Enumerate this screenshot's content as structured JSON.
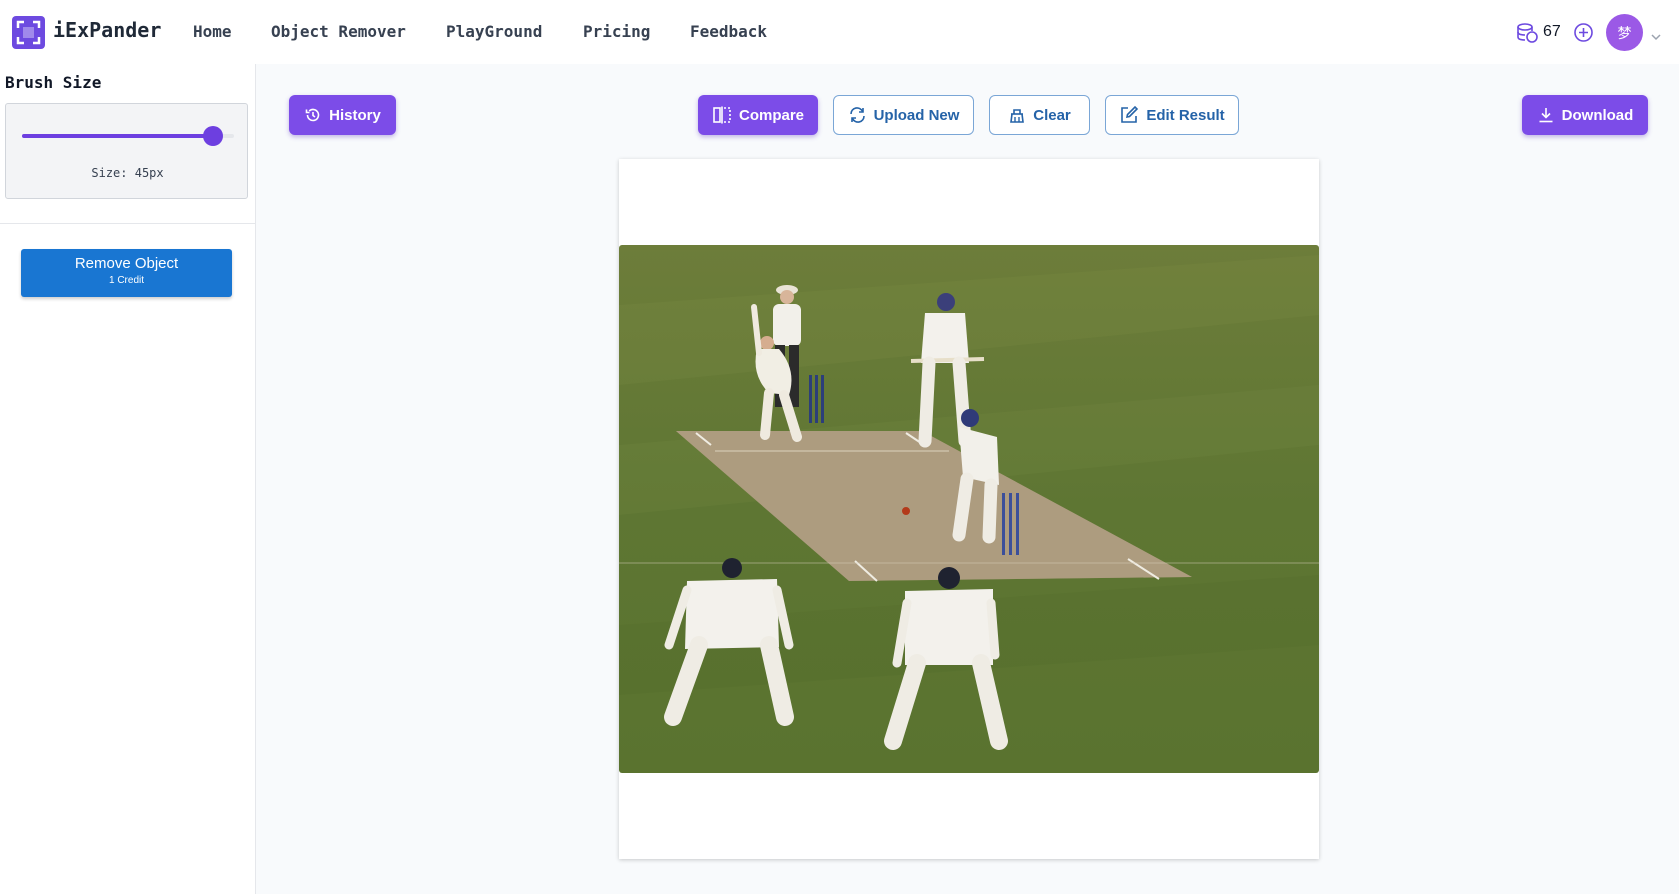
{
  "app": {
    "name": "iExPander"
  },
  "nav": {
    "home": "Home",
    "object_remover": "Object Remover",
    "playground": "PlayGround",
    "pricing": "Pricing",
    "feedback": "Feedback"
  },
  "account": {
    "credits": "67",
    "avatar_initial": "梦"
  },
  "sidebar": {
    "brush_title": "Brush Size",
    "size_label": "Size: 45px",
    "brush_level_fraction": 0.9,
    "remove_label": "Remove Object",
    "remove_cost": "1 Credit"
  },
  "toolbar": {
    "history": "History",
    "compare": "Compare",
    "upload_new": "Upload New",
    "clear": "Clear",
    "edit_result": "Edit Result",
    "download": "Download"
  },
  "colors": {
    "accent": "#7c4ce8",
    "primary_button": "#1976d2",
    "outline_text": "#2563a8"
  }
}
